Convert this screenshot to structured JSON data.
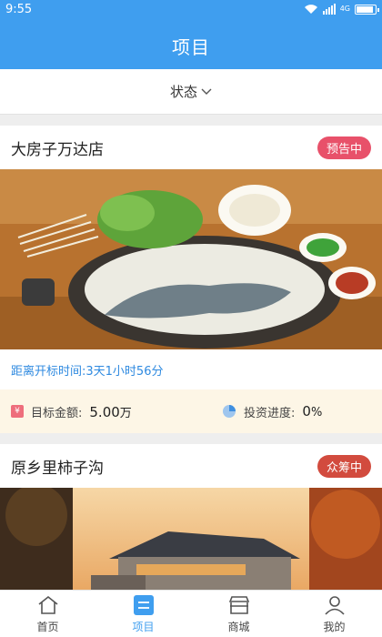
{
  "status_bar": {
    "time": "9:55",
    "network": "4G"
  },
  "header": {
    "title": "项目"
  },
  "filter": {
    "label": "状态"
  },
  "projects": [
    {
      "name": "大房子万达店",
      "badge": "预告中",
      "countdown_label": "距离开标时间:",
      "countdown_value": "3天1小时56分",
      "target_label": "目标金额:",
      "target_value": "5.00",
      "target_unit": "万",
      "progress_label": "投资进度:",
      "progress_value": "0",
      "progress_unit": "%"
    },
    {
      "name": "原乡里柿子沟",
      "badge": "众筹中"
    }
  ],
  "tabbar": {
    "items": [
      {
        "label": "首页",
        "icon": "home-icon",
        "active": false
      },
      {
        "label": "项目",
        "icon": "project-list-icon",
        "active": true
      },
      {
        "label": "商城",
        "icon": "store-icon",
        "active": false
      },
      {
        "label": "我的",
        "icon": "profile-icon",
        "active": false
      }
    ]
  },
  "colors": {
    "primary": "#3f9eef",
    "badge_preview": "#e8516a",
    "badge_crowdfunding": "#d24b3e",
    "metrics_bg": "#fdf6e6"
  }
}
